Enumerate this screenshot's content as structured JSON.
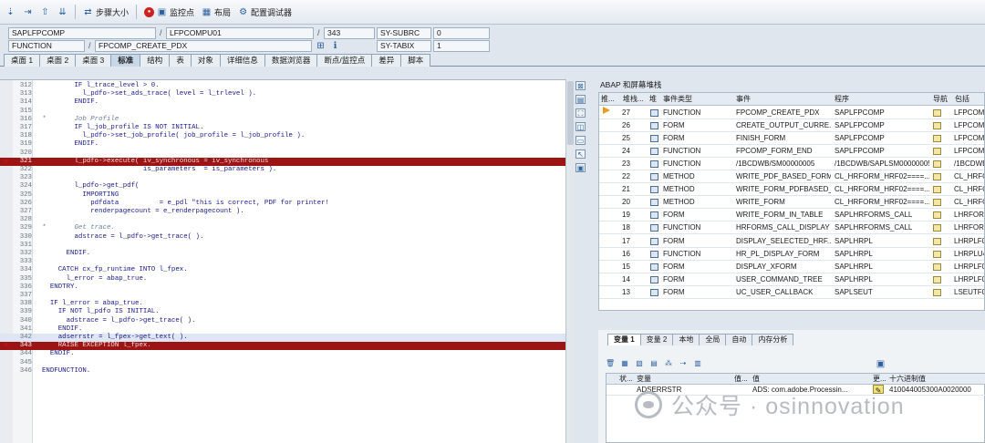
{
  "toolbar": {
    "step_size_label": "步骤大小",
    "watchpoint_label": "监控点",
    "layout_label": "布局",
    "config_label": "配置调试器"
  },
  "fields": {
    "program": "SAPLFPCOMP",
    "include": "LFPCOMPU01",
    "line": "343",
    "sysvar1": "SY-SUBRC",
    "sysvar1_value": "0",
    "event_type": "FUNCTION",
    "event": "FPCOMP_CREATE_PDX",
    "sysvar2": "SY-TABIX",
    "sysvar2_value": "1",
    "slash": "/"
  },
  "tabs": [
    "桌面 1",
    "桌面 2",
    "桌面 3",
    "标准",
    "结构",
    "表",
    "对象",
    "详细信息",
    "数据浏览器",
    "断点/监控点",
    "差异",
    "脚本"
  ],
  "code_lines": [
    {
      "n": "312",
      "t": "        IF l_trace_level > 0."
    },
    {
      "n": "313",
      "t": "          l_pdfo->set_ads_trace( level = l_trlevel )."
    },
    {
      "n": "314",
      "t": "        ENDIF."
    },
    {
      "n": "315",
      "t": ""
    },
    {
      "n": "316",
      "t": "*       Job Profile"
    },
    {
      "n": "317",
      "t": "        IF l_job_profile IS NOT INITIAL."
    },
    {
      "n": "318",
      "t": "          l_pdfo->set_job_profile( job_profile = l_job_profile )."
    },
    {
      "n": "319",
      "t": "        ENDIF."
    },
    {
      "n": "320",
      "t": ""
    },
    {
      "n": "321",
      "t": "        l_pdfo->execute( iv_synchronous = iv_synchronous"
    },
    {
      "n": "322",
      "t": "                         is_parameters  = is_parameters )."
    },
    {
      "n": "323",
      "t": ""
    },
    {
      "n": "324",
      "t": "        l_pdfo->get_pdf("
    },
    {
      "n": "325",
      "t": "          IMPORTING"
    },
    {
      "n": "326",
      "t": "            pdfdata          = e_pdl \"this is correct, PDF for printer!"
    },
    {
      "n": "327",
      "t": "            renderpagecount = e_renderpagecount )."
    },
    {
      "n": "328",
      "t": ""
    },
    {
      "n": "329",
      "t": "*       Get trace."
    },
    {
      "n": "330",
      "t": "        adstrace = l_pdfo->get_trace( )."
    },
    {
      "n": "331",
      "t": ""
    },
    {
      "n": "332",
      "t": "      ENDIF."
    },
    {
      "n": "333",
      "t": ""
    },
    {
      "n": "334",
      "t": "    CATCH cx_fp_runtime INTO l_fpex."
    },
    {
      "n": "335",
      "t": "      l_error = abap_true."
    },
    {
      "n": "336",
      "t": "  ENDTRY."
    },
    {
      "n": "337",
      "t": ""
    },
    {
      "n": "338",
      "t": "  IF l_error = abap_true."
    },
    {
      "n": "339",
      "t": "    IF NOT l_pdfo IS INITIAL."
    },
    {
      "n": "340",
      "t": "      adstrace = l_pdfo->get_trace( )."
    },
    {
      "n": "341",
      "t": "    ENDIF."
    },
    {
      "n": "342",
      "t": "    adserrstr = l_fpex->get_text( )."
    },
    {
      "n": "343",
      "t": "    RAISE EXCEPTION l_fpex."
    },
    {
      "n": "344",
      "t": "  ENDIF."
    },
    {
      "n": "345",
      "t": ""
    },
    {
      "n": "346",
      "t": "ENDFUNCTION."
    }
  ],
  "stack": {
    "title": "ABAP 和屏幕堆栈",
    "headers": [
      "推...",
      "堆栈...",
      "堆",
      "事件类型",
      "事件",
      "程序",
      "导航",
      "包括"
    ],
    "rows": [
      {
        "level": "27",
        "type": "FUNCTION",
        "event": "FPCOMP_CREATE_PDX",
        "program": "SAPLFPCOMP",
        "include": "LFPCOMP"
      },
      {
        "level": "26",
        "type": "FORM",
        "event": "CREATE_OUTPUT_CURRE...",
        "program": "SAPLFPCOMP",
        "include": "LFPCOMP"
      },
      {
        "level": "25",
        "type": "FORM",
        "event": "FINISH_FORM",
        "program": "SAPLFPCOMP",
        "include": "LFPCOMP"
      },
      {
        "level": "24",
        "type": "FUNCTION",
        "event": "FPCOMP_FORM_END",
        "program": "SAPLFPCOMP",
        "include": "LFPCOMP"
      },
      {
        "level": "23",
        "type": "FUNCTION",
        "event": "/1BCDWB/SM00000005",
        "program": "/1BCDWB/SAPLSM00000005",
        "include": "/1BCDWB"
      },
      {
        "level": "22",
        "type": "METHOD",
        "event": "WRITE_PDF_BASED_FORM",
        "program": "CL_HRFORM_HRF02====...",
        "include": "CL_HRFO"
      },
      {
        "level": "21",
        "type": "METHOD",
        "event": "WRITE_FORM_PDFBASED_...",
        "program": "CL_HRFORM_HRF02====...",
        "include": "CL_HRFO"
      },
      {
        "level": "20",
        "type": "METHOD",
        "event": "WRITE_FORM",
        "program": "CL_HRFORM_HRF02====...",
        "include": "CL_HRFO"
      },
      {
        "level": "19",
        "type": "FORM",
        "event": "WRITE_FORM_IN_TABLE",
        "program": "SAPLHRFORMS_CALL",
        "include": "LHRFORM"
      },
      {
        "level": "18",
        "type": "FUNCTION",
        "event": "HRFORMS_CALL_DISPLAY",
        "program": "SAPLHRFORMS_CALL",
        "include": "LHRFORM"
      },
      {
        "level": "17",
        "type": "FORM",
        "event": "DISPLAY_SELECTED_HRF...",
        "program": "SAPLHRPL",
        "include": "LHRPLF0"
      },
      {
        "level": "16",
        "type": "FUNCTION",
        "event": "HR_PL_DISPLAY_FORM",
        "program": "SAPLHRPL",
        "include": "LHRPLU4"
      },
      {
        "level": "15",
        "type": "FORM",
        "event": "DISPLAY_XFORM",
        "program": "SAPLHRPL",
        "include": "LHRPLF0"
      },
      {
        "level": "14",
        "type": "FORM",
        "event": "USER_COMMAND_TREE",
        "program": "SAPLHRPL",
        "include": "LHRPLF0"
      },
      {
        "level": "13",
        "type": "FORM",
        "event": "UC_USER_CALLBACK",
        "program": "SAPLSEUT",
        "include": "LSEUTF0"
      }
    ]
  },
  "var_tabs": [
    "变量 1",
    "变量 2",
    "本地",
    "全局",
    "自动",
    "内存分析"
  ],
  "var_grid": {
    "headers": [
      "状...",
      "变量",
      "值...",
      "值",
      "更...",
      "十六进制值"
    ],
    "row": {
      "variable": "ADSERRSTR",
      "value": "ADS: com.adobe.Processin...",
      "hex": "410044005300A0020000"
    }
  },
  "watermark": "公众号 · osinnovation"
}
